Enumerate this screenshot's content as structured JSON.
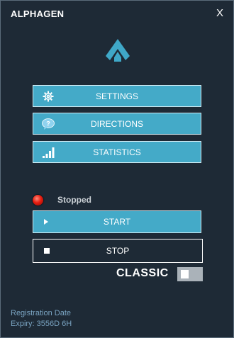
{
  "window": {
    "title": "ALPHAGEN",
    "close_label": "X"
  },
  "menu": {
    "settings_label": "SETTINGS",
    "directions_label": "DIRECTIONS",
    "statistics_label": "STATISTICS"
  },
  "status": {
    "text": "Stopped",
    "indicator_color": "#e81d10"
  },
  "controls": {
    "start_label": "START",
    "stop_label": "STOP"
  },
  "mode": {
    "label": "CLASSIC",
    "enabled": false
  },
  "registration": {
    "date_label": "Registration Date",
    "expiry": "Expiry: 3556D 6H"
  },
  "colors": {
    "accent": "#44aac8",
    "background": "#1e2a36",
    "link_text": "#7aa4c2"
  },
  "icons": {
    "logo": "alphagen-logo",
    "settings": "gear-icon",
    "directions": "question-bubble-icon",
    "statistics": "signal-bars-icon",
    "start": "play-icon",
    "stop": "stop-icon"
  }
}
